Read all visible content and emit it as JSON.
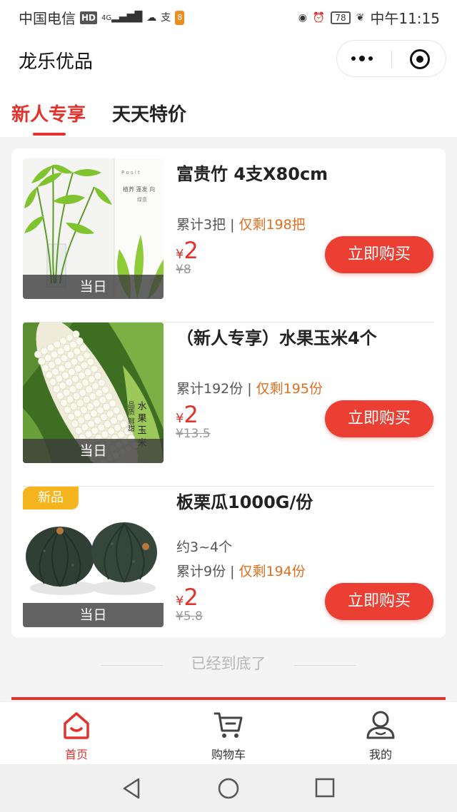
{
  "status_bar": {
    "carrier": "中国电信",
    "network_badge": "HD",
    "signal_label": "4G",
    "battery": "78",
    "time": "中午11:15",
    "icons": [
      "hd-icon",
      "signal-icon",
      "wechat-icon",
      "alipay-icon",
      "app-icon",
      "eye-icon",
      "alarm-icon",
      "battery-icon",
      "leaf-icon"
    ]
  },
  "header": {
    "title": "龙乐优品"
  },
  "tabs": [
    {
      "label": "新人专享",
      "active": true
    },
    {
      "label": "天天特价",
      "active": false
    }
  ],
  "products": [
    {
      "name": "富贵竹 4支X80cm",
      "sold": "累计3把",
      "remaining": "仅剩198把",
      "currency": "¥",
      "price": "2",
      "original_price": "¥8",
      "tag_bottom": "当日",
      "buy_label": "立即购买"
    },
    {
      "name": "（新人专享）水果玉米4个",
      "sold": "累计192份",
      "remaining": "仅剩195份",
      "currency": "¥",
      "price": "2",
      "original_price": "¥13.5",
      "tag_bottom": "当日",
      "buy_label": "立即购买"
    },
    {
      "name": "板栗瓜1000G/份",
      "note": "约3~4个",
      "sold": "累计9份",
      "remaining": "仅剩194份",
      "currency": "¥",
      "price": "2",
      "original_price": "¥5.8",
      "tag_top": "新品",
      "tag_bottom": "当日",
      "buy_label": "立即购买"
    }
  ],
  "end_note": "已经到底了",
  "bottom_nav": [
    {
      "label": "首页",
      "icon": "home-icon",
      "active": true
    },
    {
      "label": "购物车",
      "icon": "cart-icon",
      "active": false
    },
    {
      "label": "我的",
      "icon": "user-icon",
      "active": false
    }
  ],
  "colors": {
    "accent": "#e2322b",
    "remaining": "#e07020",
    "new_tag": "#f6b51e"
  }
}
